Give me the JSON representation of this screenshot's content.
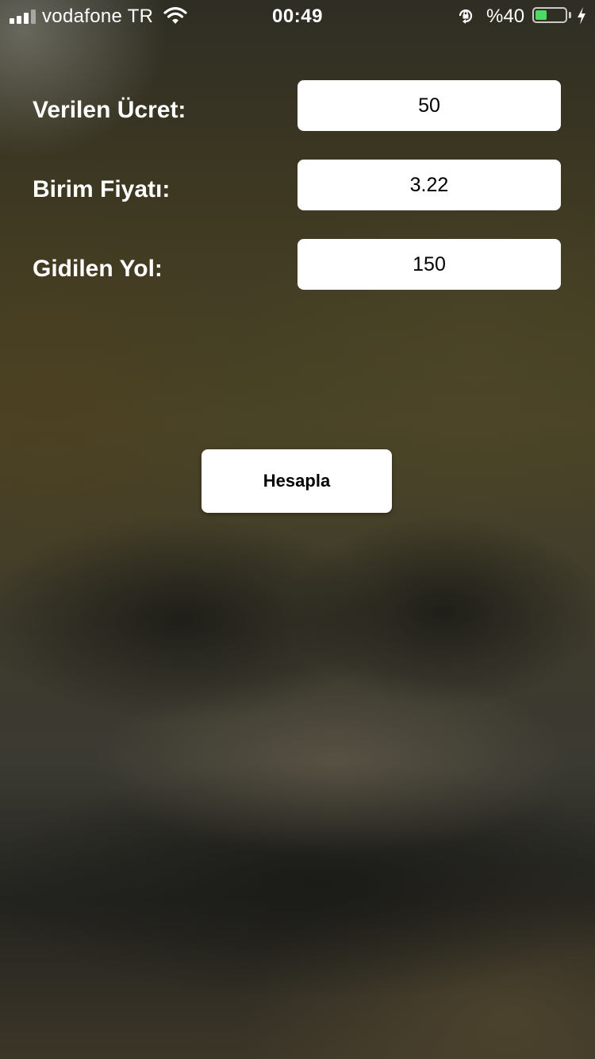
{
  "status_bar": {
    "carrier": "vodafone TR",
    "time": "00:49",
    "battery_percent": "%40",
    "battery_level": 0.4,
    "icons": {
      "signal": "cellular-signal-icon",
      "wifi": "wifi-icon",
      "rotation_lock": "rotation-lock-icon",
      "battery": "battery-icon",
      "charging": "charging-bolt-icon"
    }
  },
  "form": {
    "fields": [
      {
        "label": "Verilen Ücret:",
        "value": "50"
      },
      {
        "label": "Birim Fiyatı:",
        "value": "3.22"
      },
      {
        "label": "Gidilen Yol:",
        "value": "150"
      }
    ]
  },
  "actions": {
    "calculate_label": "Hesapla"
  },
  "colors": {
    "battery_fill": "#4cd964",
    "field_background": "#ffffff",
    "label_text": "#ffffff"
  }
}
